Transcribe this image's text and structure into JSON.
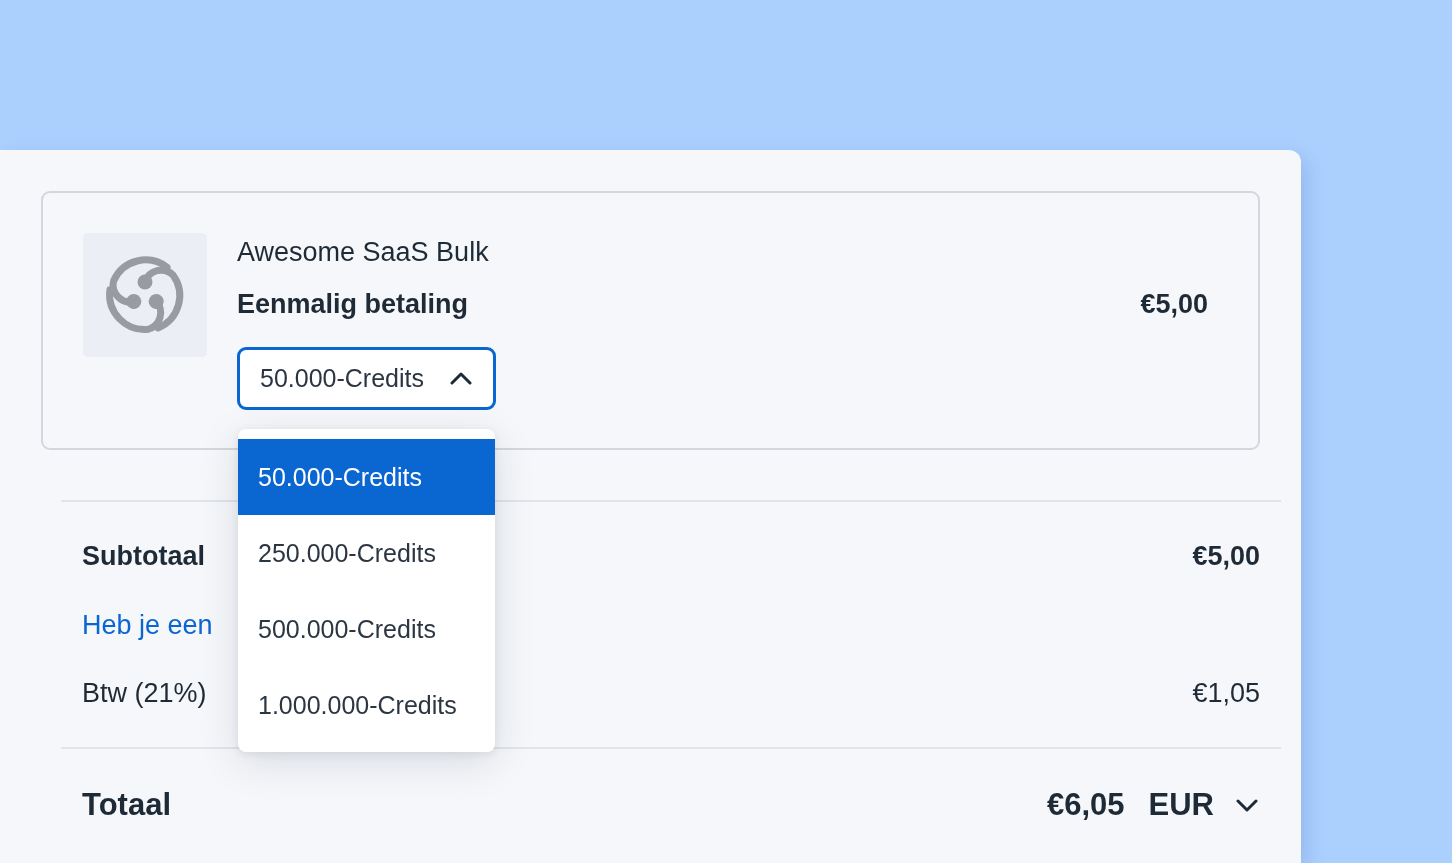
{
  "product": {
    "name": "Awesome SaaS Bulk",
    "billing": "Eenmalig betaling",
    "price": "€5,00",
    "plan_select": {
      "value": "50.000-Credits",
      "expanded": true,
      "options": [
        {
          "label": "50.000-Credits",
          "selected": true
        },
        {
          "label": "250.000-Credits",
          "selected": false
        },
        {
          "label": "500.000-Credits",
          "selected": false
        },
        {
          "label": "1.000.000-Credits",
          "selected": false
        }
      ]
    }
  },
  "summary": {
    "rows": [
      {
        "kind": "subtotal",
        "label": "Subtotaal",
        "value": "€5,00"
      },
      {
        "kind": "link",
        "label": "Heb je een"
      },
      {
        "kind": "tax",
        "label": "Btw (21%)",
        "value": "€1,05"
      }
    ],
    "total": {
      "label": "Totaal",
      "value": "€6,05",
      "currency": "EUR"
    }
  }
}
